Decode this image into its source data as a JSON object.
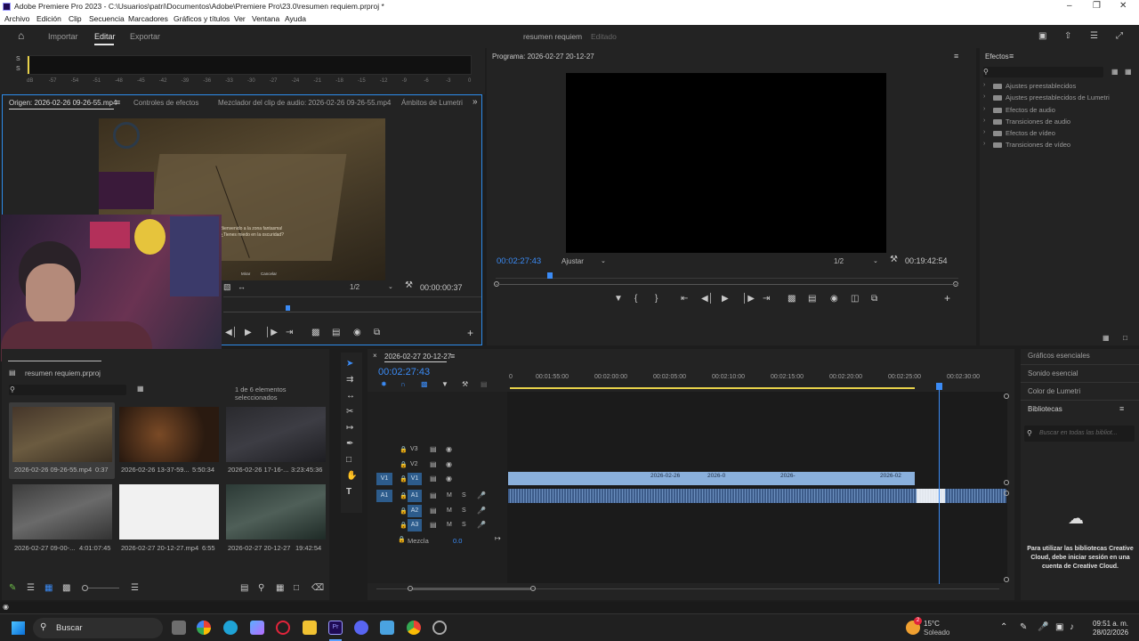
{
  "window": {
    "title": "Adobe Premiere Pro 2023 - C:\\Usuarios\\patri\\Documentos\\Adobe\\Premiere Pro\\23.0\\resumen requiem.prproj *"
  },
  "menu": [
    "Archivo",
    "Edición",
    "Clip",
    "Secuencia",
    "Marcadores",
    "Gráficos y títulos",
    "Ver",
    "Ventana",
    "Ayuda"
  ],
  "workspace": {
    "tabs": [
      "Importar",
      "Editar",
      "Exportar"
    ],
    "active_tab": "Editar",
    "project_name": "resumen requiem",
    "status": "Editado"
  },
  "audio_meter": {
    "channels": [
      "S",
      "S"
    ],
    "scale": [
      "dB",
      "-57",
      "-54",
      "-51",
      "-48",
      "-45",
      "-42",
      "-39",
      "-36",
      "-33",
      "-30",
      "-27",
      "-24",
      "-21",
      "-18",
      "-15",
      "-12",
      "-9",
      "-6",
      "-3",
      "0"
    ]
  },
  "source_panel": {
    "tabs": [
      "Origen: 2026-02-26 09-26-55.mp4",
      "Controles de efectos",
      "Mezclador del clip de audio: 2026-02-26 09-26-55.mp4",
      "Ámbitos de Lumetri"
    ],
    "resolution": "1/2",
    "timecode": "00:00:00:37",
    "overlay_text_1": "¡Bienvenido a la zona fantasma!",
    "overlay_text_2": "¿Tienes miedo en la oscuridad?",
    "overlay_buttons": [
      "Mirar",
      "Cancelar"
    ]
  },
  "program_panel": {
    "title": "Programa: 2026-02-27 20-12-27",
    "timecode": "00:02:27:43",
    "fit": "Ajustar",
    "resolution": "1/2",
    "duration": "00:19:42:54"
  },
  "effects_panel": {
    "title": "Efectos",
    "items": [
      "Ajustes preestablecidos",
      "Ajustes preestablecidos de Lumetri",
      "Efectos de audio",
      "Transiciones de audio",
      "Efectos de vídeo",
      "Transiciones de vídeo"
    ]
  },
  "side_panels": {
    "items": [
      "Gráficos esenciales",
      "Sonido esencial",
      "Color de Lumetri",
      "Bibliotecas"
    ],
    "search_placeholder": "Buscar en todas las bibliot...",
    "cc_message": "Para utilizar las bibliotecas Creative Cloud, debe iniciar sesión en una cuenta de Creative Cloud."
  },
  "project_panel": {
    "title": "resumen requiem.prproj",
    "selection": "1 de 6 elementos seleccionados",
    "items": [
      {
        "name": "2026-02-26 09-26-55.mp4",
        "duration": "0:37"
      },
      {
        "name": "2026-02-26 13-37-59...",
        "duration": "5:50:34"
      },
      {
        "name": "2026-02-26 17-16-...",
        "duration": "3:23:45:36"
      },
      {
        "name": "2026-02-27 09-00-...",
        "duration": "4:01:07:45"
      },
      {
        "name": "2026-02-27 20-12-27.mp4",
        "duration": "6:55"
      },
      {
        "name": "2026-02-27 20-12-27",
        "duration": "19:42:54"
      }
    ]
  },
  "timeline": {
    "sequence_name": "2026-02-27 20-12-27",
    "timecode": "00:02:27:43",
    "ruler": [
      "0",
      "00:01:55:00",
      "00:02:00:00",
      "00:02:05:00",
      "00:02:10:00",
      "00:02:15:00",
      "00:02:20:00",
      "00:02:25:00",
      "00:02:30:00"
    ],
    "video_tracks": [
      "V3",
      "V2",
      "V1"
    ],
    "audio_tracks": [
      "A1",
      "A2",
      "A3"
    ],
    "mix_label": "Mezcla",
    "mix_value": "0.0",
    "clip_labels": [
      "2026-02-26",
      "2026-0",
      "2026-",
      "2026-02"
    ]
  },
  "taskbar": {
    "search": "Buscar",
    "weather_temp": "15°C",
    "weather_desc": "Soleado",
    "time": "09:51 a. m.",
    "date": "28/02/2026",
    "badge": "2"
  }
}
